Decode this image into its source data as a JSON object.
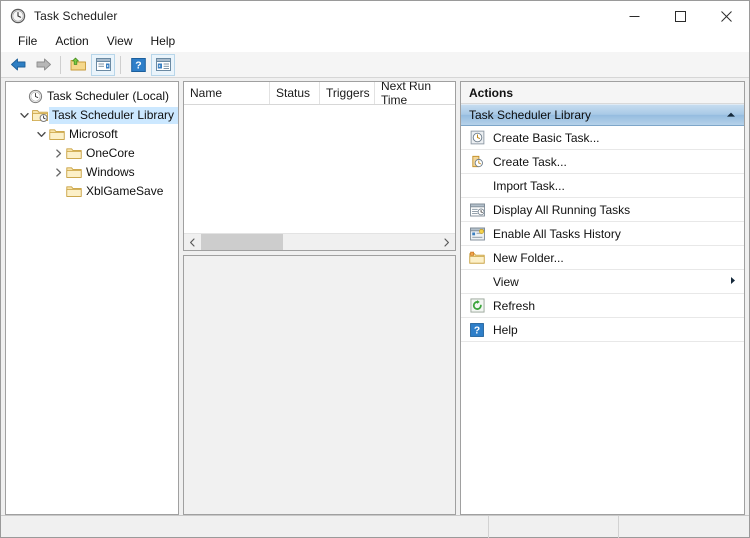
{
  "window": {
    "title": "Task Scheduler",
    "app_icon": "clock-icon",
    "controls": {
      "minimize": "minimize-icon",
      "maximize": "maximize-icon",
      "close": "close-icon"
    }
  },
  "menubar": {
    "items": [
      {
        "label": "File"
      },
      {
        "label": "Action"
      },
      {
        "label": "View"
      },
      {
        "label": "Help"
      }
    ]
  },
  "toolbar": {
    "buttons": [
      {
        "name": "back-arrow-icon",
        "framed": false
      },
      {
        "name": "forward-arrow-icon",
        "framed": false
      },
      {
        "name": "new-folder-icon",
        "framed": false
      },
      {
        "name": "properties-icon",
        "framed": true
      },
      {
        "name": "help-icon",
        "framed": false
      },
      {
        "name": "show-action-pane-icon",
        "framed": true
      }
    ]
  },
  "tree": {
    "items": [
      {
        "label": "Task Scheduler (Local)",
        "icon": "clock-icon",
        "indent": 0,
        "chevron": "none",
        "selected": false
      },
      {
        "label": "Task Scheduler Library",
        "icon": "library-folder-icon",
        "indent": 1,
        "chevron": "down",
        "selected": true
      },
      {
        "label": "Microsoft",
        "icon": "folder-icon",
        "indent": 2,
        "chevron": "down",
        "selected": false
      },
      {
        "label": "OneCore",
        "icon": "folder-icon",
        "indent": 3,
        "chevron": "right",
        "selected": false
      },
      {
        "label": "Windows",
        "icon": "folder-icon",
        "indent": 3,
        "chevron": "right",
        "selected": false
      },
      {
        "label": "XblGameSave",
        "icon": "folder-icon",
        "indent": 3,
        "chevron": "none",
        "selected": false
      }
    ]
  },
  "task_list": {
    "columns": [
      {
        "label": "Name"
      },
      {
        "label": "Status"
      },
      {
        "label": "Triggers"
      },
      {
        "label": "Next Run Time"
      }
    ],
    "rows": [],
    "hscroll": {
      "left_arrow": "chevron-left-icon",
      "right_arrow": "chevron-right-icon"
    }
  },
  "actions": {
    "title": "Actions",
    "section_header": {
      "label": "Task Scheduler Library",
      "chevron": "chevron-up-icon"
    },
    "items": [
      {
        "label": "Create Basic Task...",
        "icon": "create-basic-task-icon",
        "submenu": false
      },
      {
        "label": "Create Task...",
        "icon": "create-task-icon",
        "submenu": false
      },
      {
        "label": "Import Task...",
        "icon": "none",
        "submenu": false
      },
      {
        "label": "Display All Running Tasks",
        "icon": "running-tasks-icon",
        "submenu": false
      },
      {
        "label": "Enable All Tasks History",
        "icon": "history-icon",
        "submenu": false
      },
      {
        "label": "New Folder...",
        "icon": "new-folder-icon",
        "submenu": false
      },
      {
        "label": "View",
        "icon": "none",
        "submenu": true
      },
      {
        "label": "Refresh",
        "icon": "refresh-icon",
        "submenu": false
      },
      {
        "label": "Help",
        "icon": "help-icon",
        "submenu": false
      }
    ]
  },
  "statusbar": {
    "cells": [
      "",
      "",
      ""
    ]
  },
  "colors": {
    "selection": "#cce8ff",
    "section_header": "#a8c9e6",
    "window_bg": "#f0f0f0",
    "pane_bg": "#ffffff",
    "detail_bg": "#f1f1f1"
  }
}
